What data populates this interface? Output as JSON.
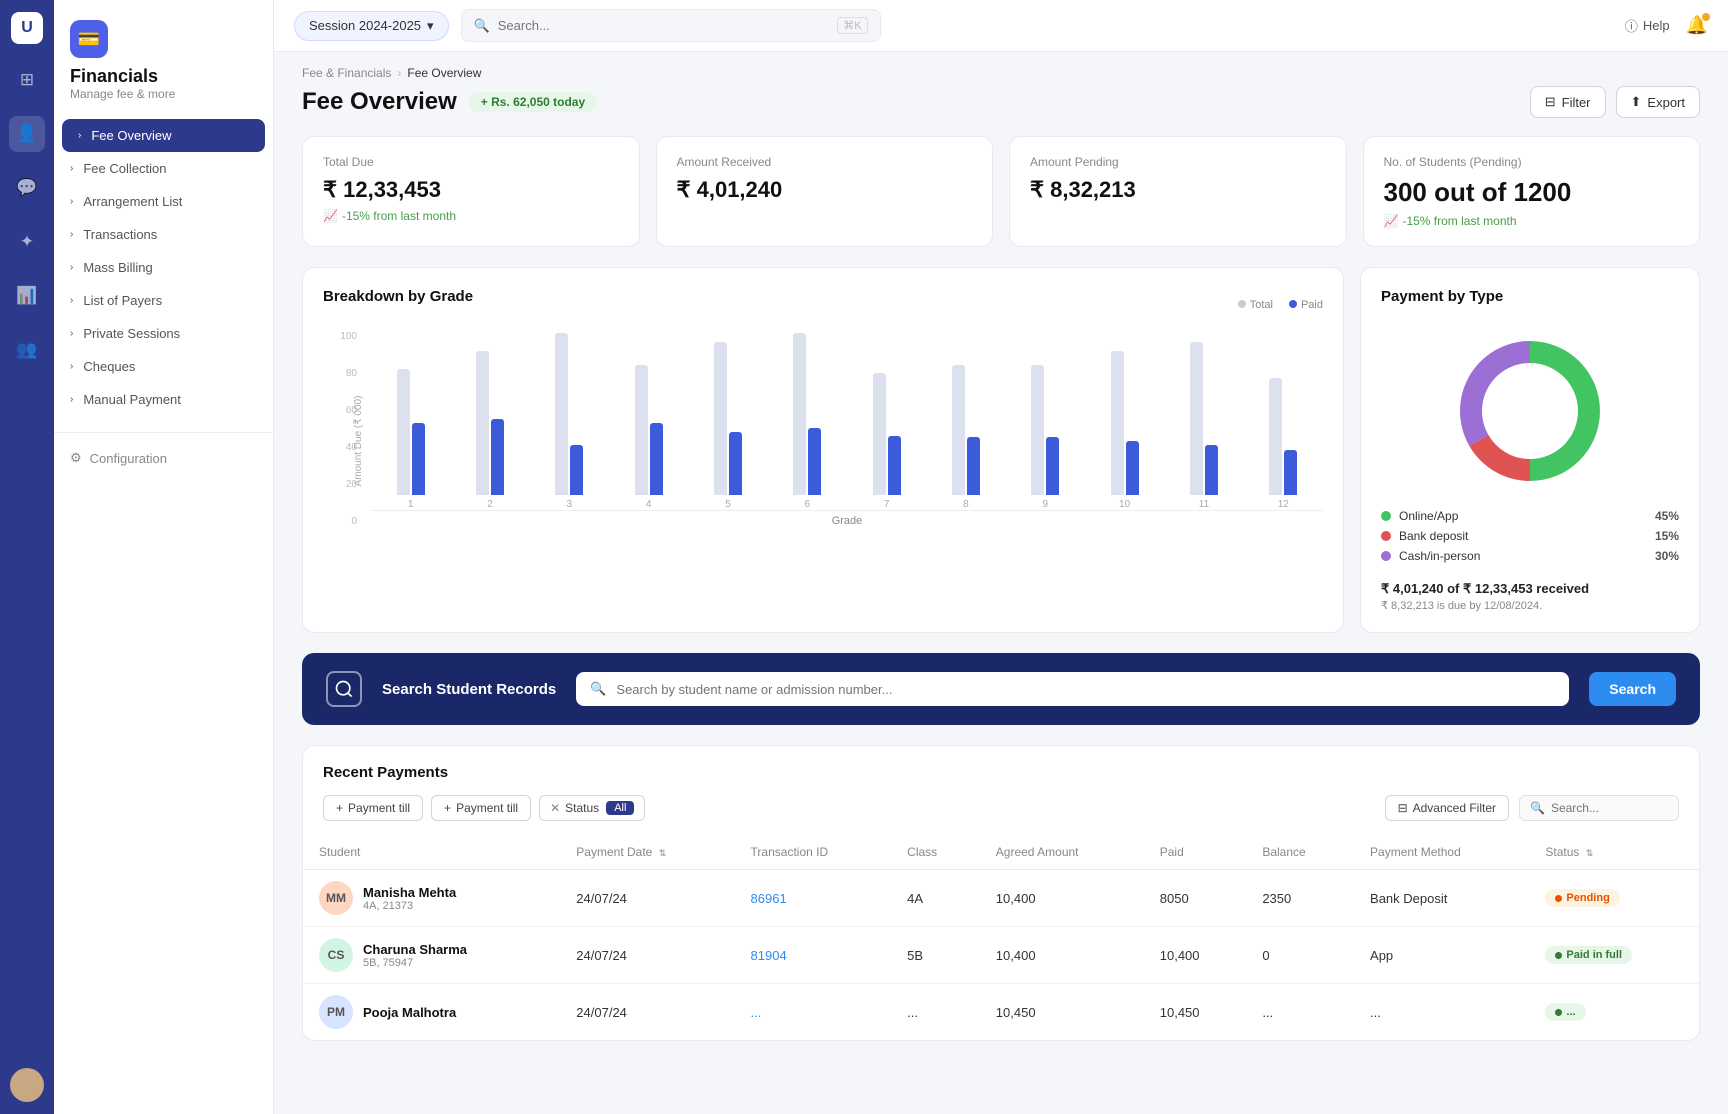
{
  "app": {
    "logo_letter": "U",
    "nav_icons": [
      "⊞",
      "👤",
      "💬",
      "⭐",
      "📦",
      "👥"
    ],
    "active_nav": 1
  },
  "sidebar": {
    "title": "Financials",
    "subtitle": "Manage fee & more",
    "icon": "💰",
    "items": [
      {
        "id": "fee-overview",
        "label": "Fee Overview",
        "active": true
      },
      {
        "id": "fee-collection",
        "label": "Fee Collection",
        "active": false
      },
      {
        "id": "arrangement-list",
        "label": "Arrangement List",
        "active": false
      },
      {
        "id": "transactions",
        "label": "Transactions",
        "active": false
      },
      {
        "id": "mass-billing",
        "label": "Mass Billing",
        "active": false
      },
      {
        "id": "list-of-payers",
        "label": "List of Payers",
        "active": false
      },
      {
        "id": "private-sessions",
        "label": "Private Sessions",
        "active": false
      },
      {
        "id": "cheques",
        "label": "Cheques",
        "active": false
      },
      {
        "id": "manual-payment",
        "label": "Manual Payment",
        "active": false
      }
    ],
    "config_label": "Configuration"
  },
  "topbar": {
    "session_label": "Session 2024-2025",
    "search_placeholder": "Search...",
    "search_shortcut": "⌘K",
    "help_label": "Help"
  },
  "breadcrumb": {
    "parent": "Fee & Financials",
    "current": "Fee Overview"
  },
  "page": {
    "title": "Fee Overview",
    "today_badge": "+ Rs. 62,050 today",
    "filter_label": "Filter",
    "export_label": "Export"
  },
  "stats": [
    {
      "label": "Total Due",
      "value": "₹ 12,33,453",
      "change": "-15% from last month",
      "change_dir": "up"
    },
    {
      "label": "Amount Received",
      "value": "₹ 4,01,240",
      "change": null
    },
    {
      "label": "Amount Pending",
      "value": "₹ 8,32,213",
      "change": null
    },
    {
      "label": "No. of Students (Pending)",
      "value": "300 out of 1200",
      "change": "-15% from last month",
      "change_dir": "up",
      "large": true
    }
  ],
  "bar_chart": {
    "title": "Breakdown by Grade",
    "legend_total": "Total",
    "legend_paid": "Paid",
    "y_axis_label": "Amount Due (₹ 000)",
    "x_axis_label": "Grade",
    "y_labels": [
      "100",
      "80",
      "60",
      "40",
      "20",
      "0"
    ],
    "grades": [
      1,
      2,
      3,
      4,
      5,
      6,
      7,
      8,
      9,
      10,
      11,
      12
    ],
    "total_heights": [
      70,
      80,
      90,
      72,
      85,
      90,
      68,
      72,
      72,
      80,
      85,
      65
    ],
    "paid_heights": [
      40,
      42,
      28,
      40,
      35,
      37,
      33,
      32,
      32,
      30,
      28,
      25
    ]
  },
  "donut_chart": {
    "title": "Payment by Type",
    "segments": [
      {
        "label": "Online/App",
        "pct": 45,
        "color": "#43c463"
      },
      {
        "label": "Bank deposit",
        "pct": 15,
        "color": "#e05353"
      },
      {
        "label": "Cash/in-person",
        "pct": 30,
        "color": "#9c6fd4"
      }
    ],
    "summary_received": "₹ 4,01,240 of ₹ 12,33,453 received",
    "summary_due": "₹ 8,32,213 is due by 12/08/2024."
  },
  "search_section": {
    "label": "Search Student Records",
    "placeholder": "Search by student name or admission number...",
    "btn_label": "Search"
  },
  "recent_payments": {
    "title": "Recent Payments",
    "filters": {
      "payment_till_1": "Payment till",
      "payment_till_2": "Payment till",
      "status_label": "Status",
      "status_value": "All",
      "advanced_filter": "Advanced Filter",
      "search_placeholder": "Search..."
    },
    "columns": [
      "Student",
      "Payment Date",
      "Transaction ID",
      "Class",
      "Agreed Amount",
      "Paid",
      "Balance",
      "Payment Method",
      "Status"
    ],
    "rows": [
      {
        "name": "Manisha Mehta",
        "id_label": "4A, 21373",
        "avatar_text": "MM",
        "avatar_color": "#ffd6c2",
        "date": "24/07/24",
        "tx_id": "86961",
        "class": "4A",
        "agreed": "10,400",
        "paid": "8050",
        "balance": "2350",
        "method": "Bank Deposit",
        "status": "Pending",
        "status_type": "pending"
      },
      {
        "name": "Charuna Sharma",
        "id_label": "5B, 75947",
        "avatar_text": "CS",
        "avatar_color": "#d2f5e3",
        "date": "24/07/24",
        "tx_id": "81904",
        "class": "5B",
        "agreed": "10,400",
        "paid": "10,400",
        "balance": "0",
        "method": "App",
        "status": "Paid in full",
        "status_type": "paid"
      },
      {
        "name": "Pooja Malhotra",
        "id_label": "",
        "avatar_text": "PM",
        "avatar_color": "#d6e4ff",
        "date": "24/07/24",
        "tx_id": "...",
        "class": "...",
        "agreed": "10,450",
        "paid": "10,450",
        "balance": "...",
        "method": "...",
        "status": "...",
        "status_type": "paid"
      }
    ]
  }
}
